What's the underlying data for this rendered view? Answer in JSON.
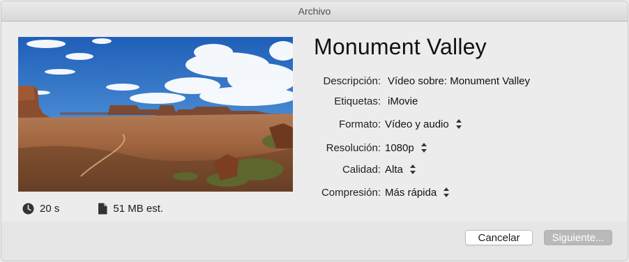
{
  "window": {
    "title": "Archivo"
  },
  "preview": {
    "duration": "20 s",
    "size": "51 MB est."
  },
  "project": {
    "title": "Monument Valley"
  },
  "fields": {
    "description": {
      "label": "Descripción:",
      "value": "Vídeo sobre: Monument Valley"
    },
    "tags": {
      "label": "Etiquetas:",
      "value": "iMovie"
    },
    "format": {
      "label": "Formato:",
      "value": "Vídeo y audio"
    },
    "resolution": {
      "label": "Resolución:",
      "value": "1080p"
    },
    "quality": {
      "label": "Calidad:",
      "value": "Alta"
    },
    "compression": {
      "label": "Compresión:",
      "value": "Más rápida"
    }
  },
  "buttons": {
    "cancel": "Cancelar",
    "next": "Siguiente..."
  },
  "colors": {
    "window_bg": "#ececec",
    "next_button_disabled": "#b9b9b9"
  }
}
